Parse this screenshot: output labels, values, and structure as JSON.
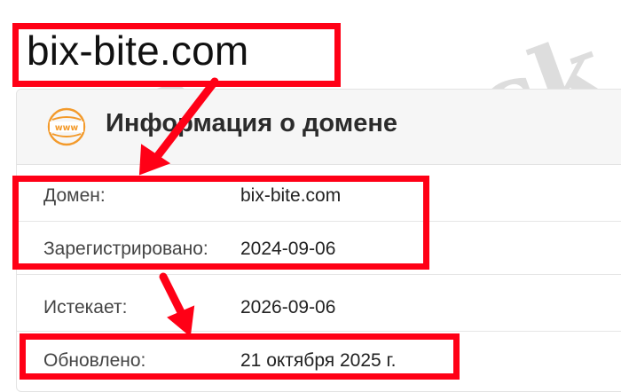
{
  "heading": "bix-bite.com",
  "card": {
    "title": "Информация о домене",
    "icon_text": "www",
    "rows": [
      {
        "label": "Домен:",
        "value": "bix-bite.com"
      },
      {
        "label": "Зарегистрировано:",
        "value": "2024-09-06"
      },
      {
        "label": "Истекает:",
        "value": "2026-09-06"
      },
      {
        "label": "Обновлено:",
        "value": "21 октября 2025 г."
      }
    ]
  },
  "watermark": "Forteck",
  "colors": {
    "highlight": "#ff0016",
    "icon_orange": "#f39a2b",
    "header_bg": "#f6f6f6"
  }
}
